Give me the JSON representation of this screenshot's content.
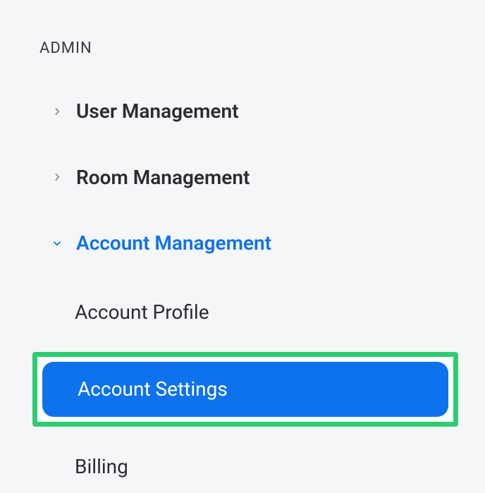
{
  "section": {
    "header": "ADMIN"
  },
  "nav": {
    "items": [
      {
        "label": "User Management",
        "expanded": false
      },
      {
        "label": "Room Management",
        "expanded": false
      },
      {
        "label": "Account Management",
        "expanded": true
      }
    ]
  },
  "subnav": {
    "items": [
      {
        "label": "Account Profile",
        "selected": false,
        "highlighted": false
      },
      {
        "label": "Account Settings",
        "selected": true,
        "highlighted": true
      },
      {
        "label": "Billing",
        "selected": false,
        "highlighted": false
      }
    ]
  },
  "colors": {
    "accent": "#0e72ed",
    "highlight_border": "#2ecc71"
  }
}
